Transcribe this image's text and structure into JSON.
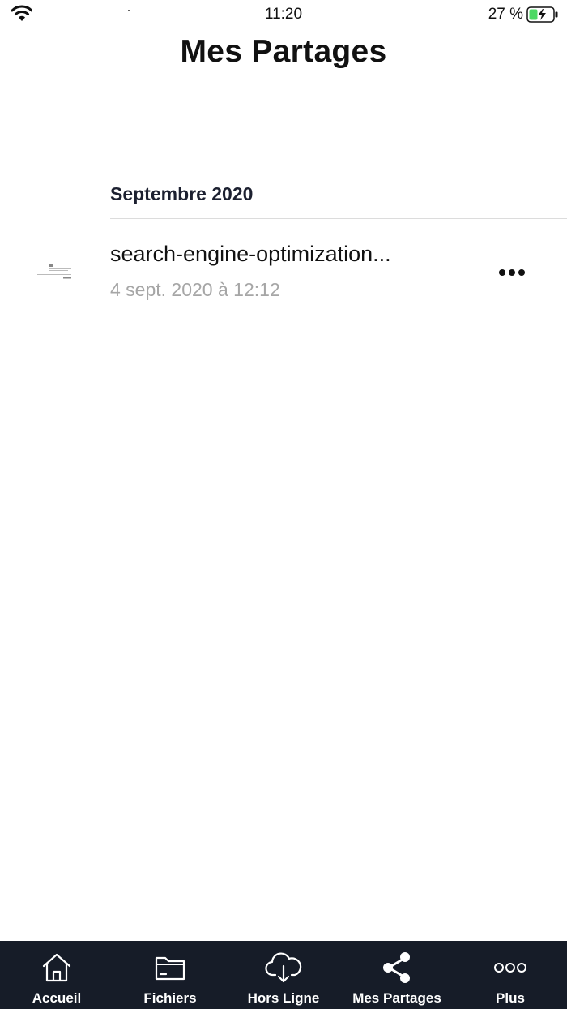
{
  "status_bar": {
    "time": "11:20",
    "battery_percent": "27 %"
  },
  "header": {
    "title": "Mes Partages"
  },
  "shares": {
    "section_title": "Septembre 2020",
    "items": [
      {
        "file_name": "search-engine-optimization...",
        "date": "4 sept. 2020 à 12:12",
        "thumbnail_icon": "document-thumbnail",
        "menu_icon": "more-horizontal-icon"
      }
    ]
  },
  "tab_bar": {
    "active_tab": "Mes Partages",
    "tabs": [
      {
        "label": "Accueil",
        "icon": "home-icon"
      },
      {
        "label": "Fichiers",
        "icon": "folder-icon"
      },
      {
        "label": "Hors Ligne",
        "icon": "cloud-download-icon"
      },
      {
        "label": "Mes Partages",
        "icon": "share-icon"
      },
      {
        "label": "Plus",
        "icon": "more-circles-icon"
      }
    ]
  },
  "colors": {
    "tab_bar_background": "#161c28",
    "date_text": "#a6a6a6",
    "battery_charging": "#4cd964"
  }
}
